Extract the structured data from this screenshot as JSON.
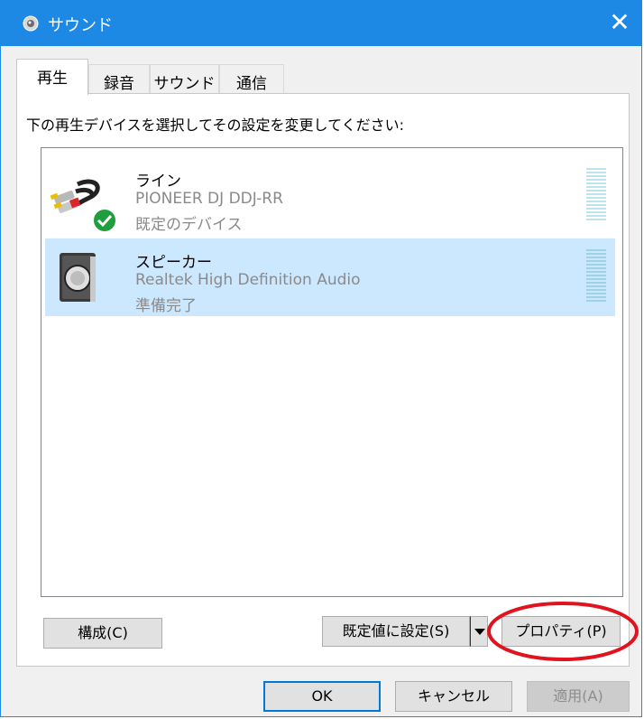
{
  "window": {
    "title": "サウンド",
    "close_glyph": "✕"
  },
  "tabs": [
    {
      "label": "再生",
      "active": true
    },
    {
      "label": "録音",
      "active": false
    },
    {
      "label": "サウンド",
      "active": false
    },
    {
      "label": "通信",
      "active": false
    }
  ],
  "instruction": "下の再生デバイスを選択してその設定を変更してください:",
  "devices": [
    {
      "name": "ライン",
      "description": "PIONEER DJ DDJ-RR",
      "status": "既定のデバイス",
      "icon": "rca-cable-icon",
      "badge": "default-check-icon",
      "selected": false
    },
    {
      "name": "スピーカー",
      "description": "Realtek High Definition Audio",
      "status": "準備完了",
      "icon": "speaker-icon",
      "selected": true
    }
  ],
  "buttons": {
    "configure": "構成(C)",
    "set_default": "既定値に設定(S)",
    "properties": "プロパティ(P)",
    "ok": "OK",
    "cancel": "キャンセル",
    "apply": "適用(A)"
  },
  "colors": {
    "titlebar": "#1e88e5",
    "selection": "#cce8ff",
    "highlight_oval": "#e0141e",
    "check_badge": "#1e9e3c"
  }
}
